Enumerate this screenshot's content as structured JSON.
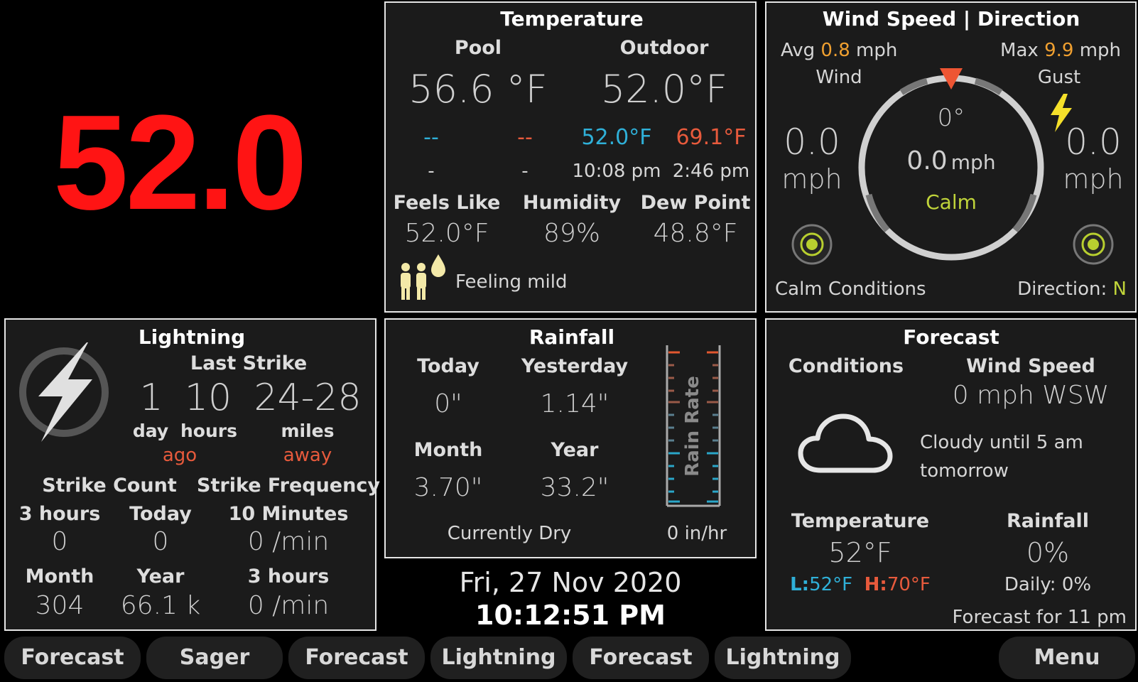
{
  "main_temp": "52.0",
  "temperature": {
    "title": "Temperature",
    "pool_label": "Pool",
    "outdoor_label": "Outdoor",
    "pool_value": "56.6 °F",
    "outdoor_value": "52.0°F",
    "pool_low": "--",
    "pool_high": "--",
    "pool_low_time": "-",
    "pool_high_time": "-",
    "outdoor_low": "52.0°F",
    "outdoor_high": "69.1°F",
    "outdoor_low_time": "10:08 pm",
    "outdoor_high_time": "2:46 pm",
    "feels_like_label": "Feels Like",
    "feels_like_value": "52.0°F",
    "humidity_label": "Humidity",
    "humidity_value": "89%",
    "dew_point_label": "Dew Point",
    "dew_point_value": "48.8°F",
    "comfort_text": "Feeling mild"
  },
  "wind": {
    "title": "Wind Speed  |  Direction",
    "avg_label": "Avg",
    "avg_value": "0.8",
    "avg_unit": "mph",
    "max_label": "Max",
    "max_value": "9.9",
    "max_unit": "mph",
    "wind_label": "Wind",
    "gust_label": "Gust",
    "wind_value": "0.0",
    "wind_unit": "mph",
    "gust_value": "0.0",
    "gust_unit": "mph",
    "direction_deg": "0°",
    "center_speed": "0.0",
    "center_unit": "mph",
    "center_status": "Calm",
    "conditions_text": "Calm Conditions",
    "direction_label": "Direction:",
    "direction_value": "N"
  },
  "lightning": {
    "title": "Lightning",
    "last_strike_label": "Last Strike",
    "days": "1",
    "hours": "10",
    "distance": "24-28",
    "day_label": "day",
    "hours_label": "hours",
    "miles_label": "miles",
    "ago_label": "ago",
    "away_label": "away",
    "strike_count_label": "Strike Count",
    "strike_freq_label": "Strike Frequency",
    "col_3h_label": "3 hours",
    "col_today_label": "Today",
    "col_10m_label": "10 Minutes",
    "count_3h": "0",
    "count_today": "0",
    "freq_10m": "0 /min",
    "col_month_label": "Month",
    "col_year_label": "Year",
    "col_3h2_label": "3 hours",
    "count_month": "304",
    "count_year": "66.1 k",
    "freq_3h": "0 /min"
  },
  "rainfall": {
    "title": "Rainfall",
    "today_label": "Today",
    "yesterday_label": "Yesterday",
    "today_value": "0\"",
    "yesterday_value": "1.14\"",
    "month_label": "Month",
    "year_label": "Year",
    "month_value": "3.70\"",
    "year_value": "33.2\"",
    "rain_rate_label": "Rain Rate",
    "status_text": "Currently Dry",
    "rate_value": "0 in/hr",
    "rate_fraction": 0
  },
  "forecast": {
    "title": "Forecast",
    "conditions_label": "Conditions",
    "wind_label": "Wind Speed",
    "wind_value": "0 mph WSW",
    "summary_line1": "Cloudy until 5 am",
    "summary_line2": "tomorrow",
    "temperature_label": "Temperature",
    "rainfall_label": "Rainfall",
    "temp_value": "52°F",
    "low_label": "L:",
    "low_value": "52°F",
    "high_label": "H:",
    "high_value": "70°F",
    "rain_value": "0%",
    "daily_text": "Daily: 0%",
    "forecast_for": "Forecast for 11 pm"
  },
  "clock": {
    "date": "Fri, 27 Nov 2020",
    "time": "10:12:51 PM"
  },
  "buttons": [
    "Forecast",
    "Sager",
    "Forecast",
    "Lightning",
    "Forecast",
    "Lightning",
    "Menu"
  ],
  "colors": {
    "main_temp": "#ff1414",
    "low": "#2fb0d8",
    "high": "#e75a3c",
    "accent_orange": "#f0a030",
    "accent_green": "#c0d43a"
  }
}
